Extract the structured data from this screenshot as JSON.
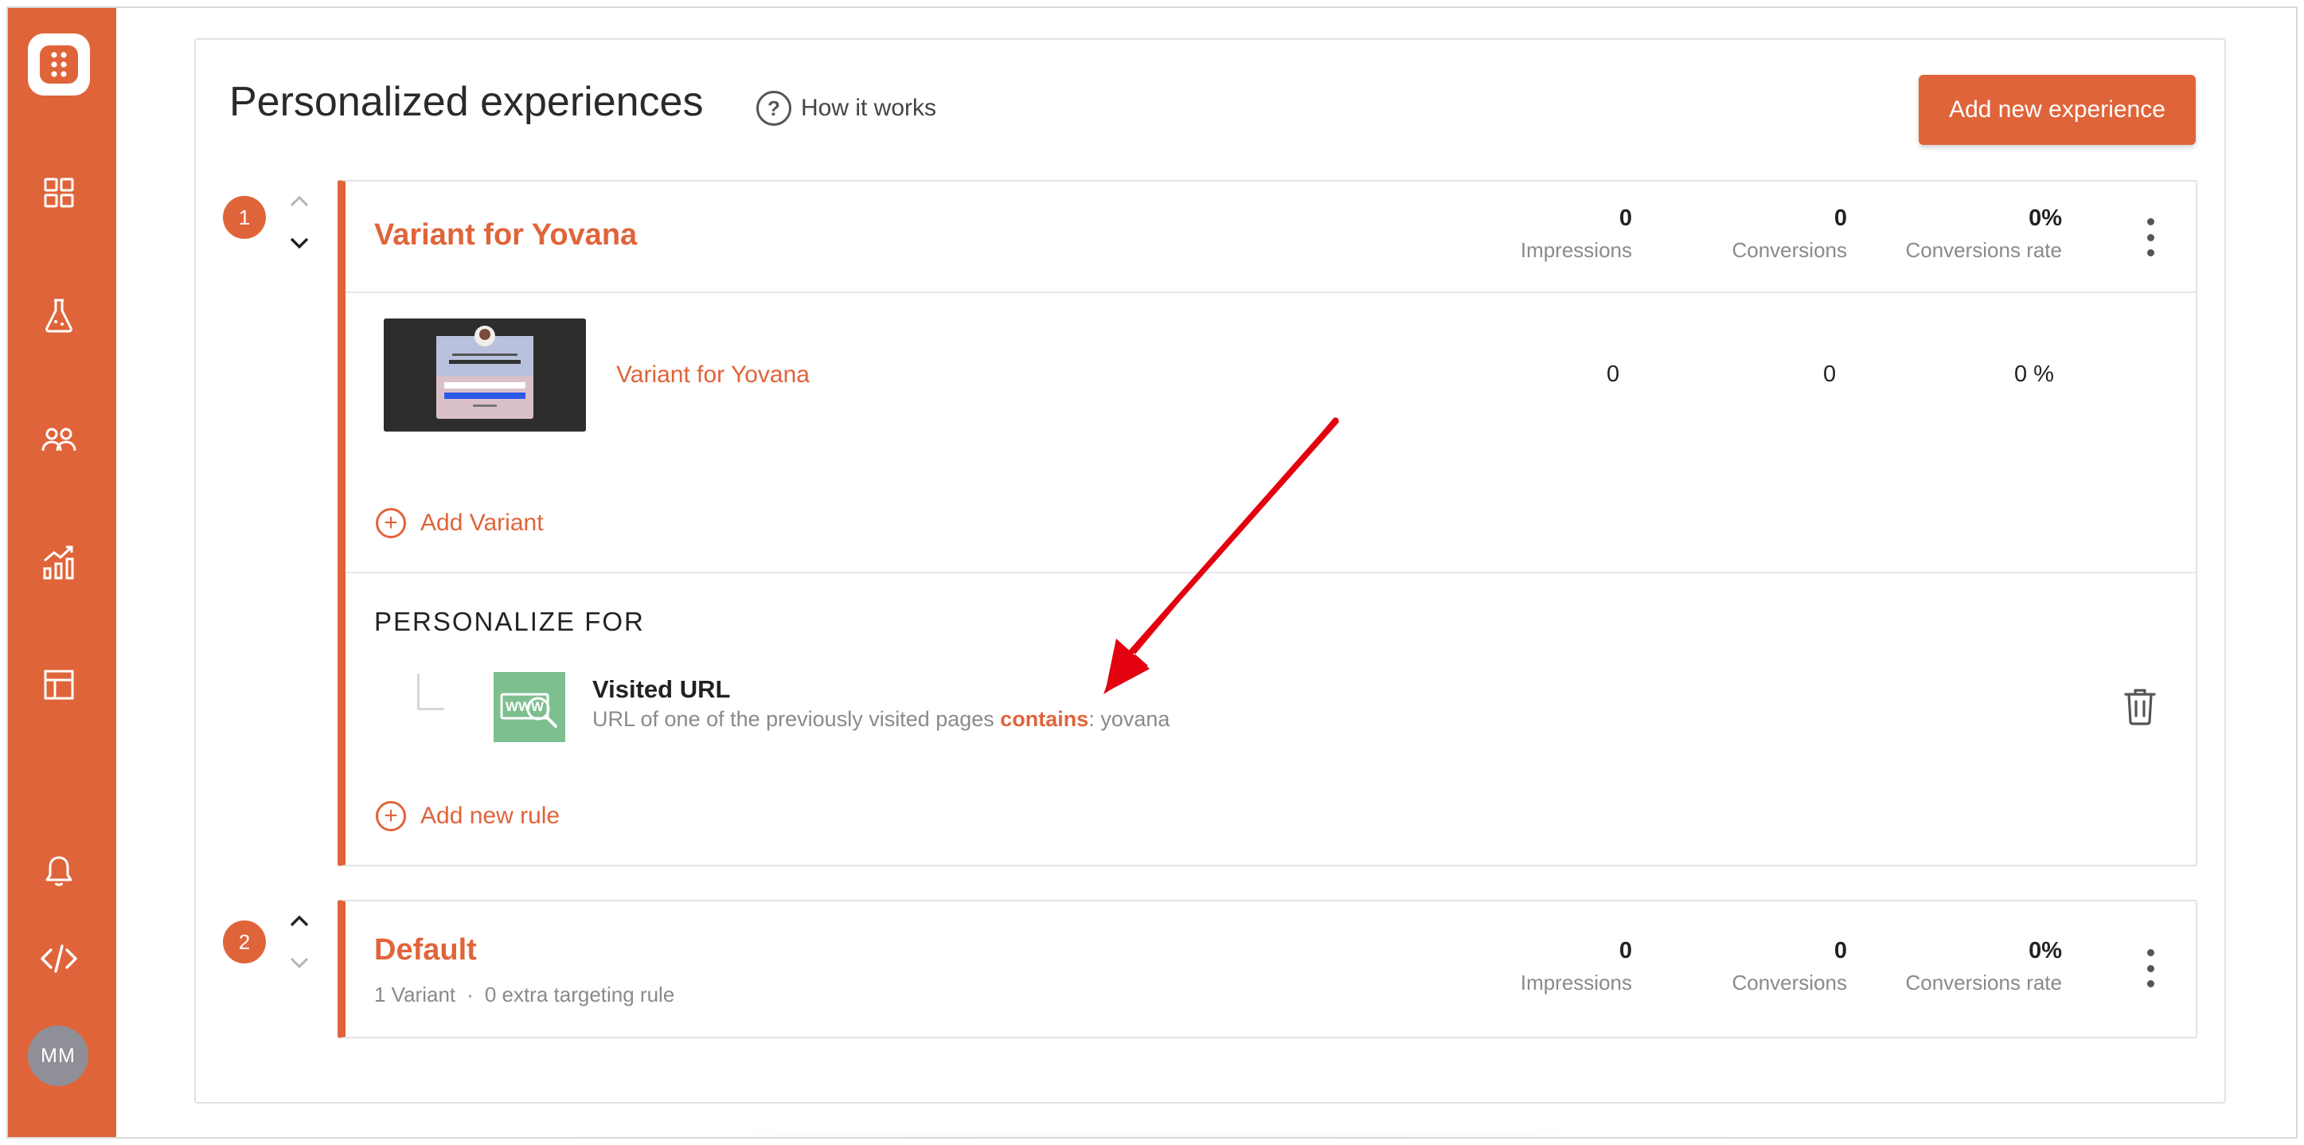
{
  "app": {
    "colors": {
      "accent": "#e0643a",
      "sidebar": "#e0643a",
      "avatar_bg": "#8f9097",
      "url_icon_bg": "#7dbf8e",
      "annotation_arrow": "#e3000f"
    }
  },
  "sidebar": {
    "logo_icon": "grid-dots-logo-icon",
    "items": [
      {
        "icon": "dashboard-grid-icon"
      },
      {
        "icon": "flask-icon"
      },
      {
        "icon": "users-icon"
      },
      {
        "icon": "analytics-chart-icon"
      },
      {
        "icon": "layout-template-icon"
      }
    ],
    "bottom_items": [
      {
        "icon": "bell-icon"
      },
      {
        "icon": "code-icon"
      }
    ],
    "avatar_initials": "MM"
  },
  "header": {
    "title": "Personalized experiences",
    "help_label": "How it works",
    "help_icon": "?",
    "add_button_label": "Add new experience"
  },
  "experiences": [
    {
      "order": "1",
      "title": "Variant for Yovana",
      "stats": {
        "impressions_value": "0",
        "impressions_label": "Impressions",
        "conversions_value": "0",
        "conversions_label": "Conversions",
        "rate_value": "0%",
        "rate_label": "Conversions rate"
      },
      "variants": [
        {
          "name": "Variant for Yovana",
          "impressions": "0",
          "conversions": "0",
          "rate": "0 %"
        }
      ],
      "add_variant_label": "Add Variant",
      "personalize_heading": "PERSONALIZE FOR",
      "rules": [
        {
          "icon_text": "WWW",
          "title": "Visited URL",
          "desc_prefix": "URL of one of the previously visited pages ",
          "operator": "contains",
          "desc_suffix": ": yovana"
        }
      ],
      "add_rule_label": "Add new rule"
    },
    {
      "order": "2",
      "title": "Default",
      "meta_variants": "1 Variant",
      "meta_separator": "·",
      "meta_rules": "0 extra targeting rule",
      "stats": {
        "impressions_value": "0",
        "impressions_label": "Impressions",
        "conversions_value": "0",
        "conversions_label": "Conversions",
        "rate_value": "0%",
        "rate_label": "Conversions rate"
      }
    }
  ]
}
